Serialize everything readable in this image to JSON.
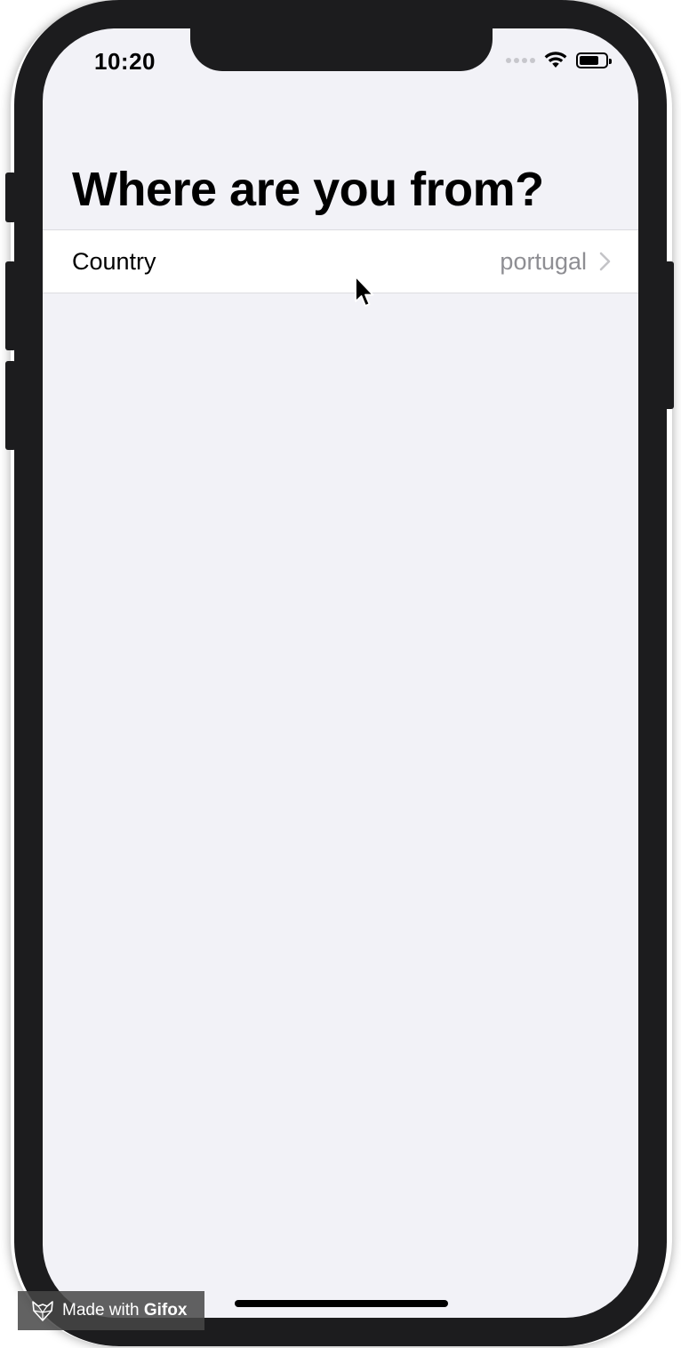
{
  "status_bar": {
    "time": "10:20",
    "signal_icon": "signal-dots-icon",
    "wifi_icon": "wifi-icon",
    "battery_icon": "battery-icon",
    "battery_level": 0.75
  },
  "page": {
    "title": "Where are you from?"
  },
  "form": {
    "rows": [
      {
        "label": "Country",
        "value": "portugal",
        "accessory_icon": "chevron-right-icon"
      }
    ]
  },
  "watermark": {
    "prefix": "Made with ",
    "brand": "Gifox",
    "icon": "gifox-logo-icon"
  },
  "colors": {
    "background": "#f2f2f7",
    "cell_background": "#ffffff",
    "secondary_text": "#8e8e93",
    "device_frame": "#1c1c1e"
  }
}
